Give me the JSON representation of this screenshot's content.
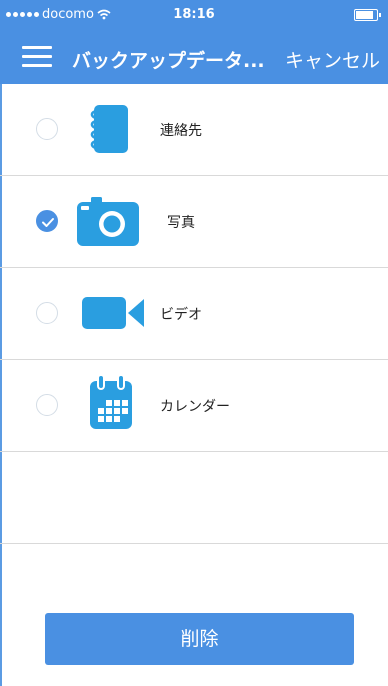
{
  "status_bar": {
    "carrier": "docomo",
    "time": "18:16",
    "battery_level": 0.85
  },
  "nav": {
    "title": "バックアップデータ...",
    "cancel_label": "キャンセル",
    "menu_icon": "hamburger-icon"
  },
  "items": [
    {
      "label": "連絡先",
      "icon": "contacts-notebook-icon",
      "selected": false
    },
    {
      "label": "写真",
      "icon": "camera-icon",
      "selected": true
    },
    {
      "label": "ビデオ",
      "icon": "video-camera-icon",
      "selected": false
    },
    {
      "label": "カレンダー",
      "icon": "calendar-icon",
      "selected": false
    }
  ],
  "delete_button_label": "削除",
  "colors": {
    "accent": "#4a90e2",
    "icon": "#2a9ee0",
    "divider": "#d9d9d9"
  }
}
